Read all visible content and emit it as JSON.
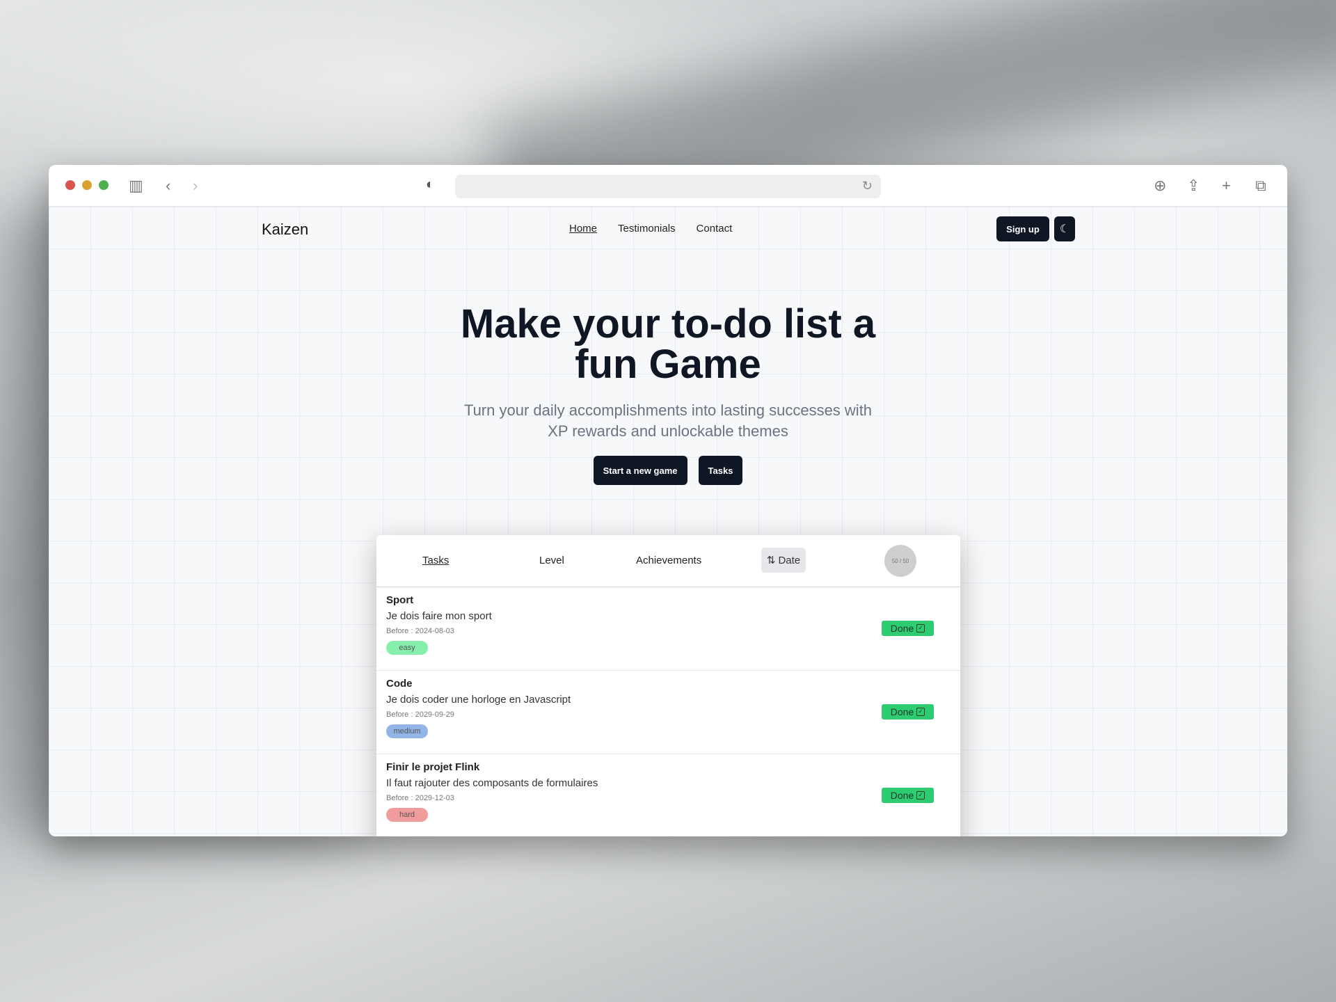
{
  "browser": {
    "reload_icon": "↻"
  },
  "nav": {
    "logo": "Kaizen",
    "links": [
      "Home",
      "Testimonials",
      "Contact"
    ],
    "signup": "Sign up"
  },
  "hero": {
    "title": "Make your to-do list a fun Game",
    "subtitle": "Turn your daily accomplishments into lasting successes with XP rewards and unlockable themes",
    "primary_button": "Start a new game",
    "secondary_button": "Tasks"
  },
  "panel": {
    "tabs": [
      "Tasks",
      "Level",
      "Achievements"
    ],
    "sort_label": "Date",
    "avatar_text": "50 / 50",
    "tasks": [
      {
        "title": "Sport",
        "description": "Je dois faire mon sport",
        "date": "Before : 2024-08-03",
        "difficulty": "easy",
        "action": "Done"
      },
      {
        "title": "Code",
        "description": "Je dois coder une horloge en Javascript",
        "date": "Before : 2029-09-29",
        "difficulty": "medium",
        "action": "Done"
      },
      {
        "title": "Finir le projet Flink",
        "description": "Il faut rajouter des composants de formulaires",
        "date": "Before : 2029-12-03",
        "difficulty": "hard",
        "action": "Done"
      }
    ]
  },
  "colors": {
    "accent_dark": "#0f1624",
    "done_green": "#2ecc71",
    "easy": "#86efac",
    "medium": "#93b4e6",
    "hard": "#f19c9c"
  }
}
